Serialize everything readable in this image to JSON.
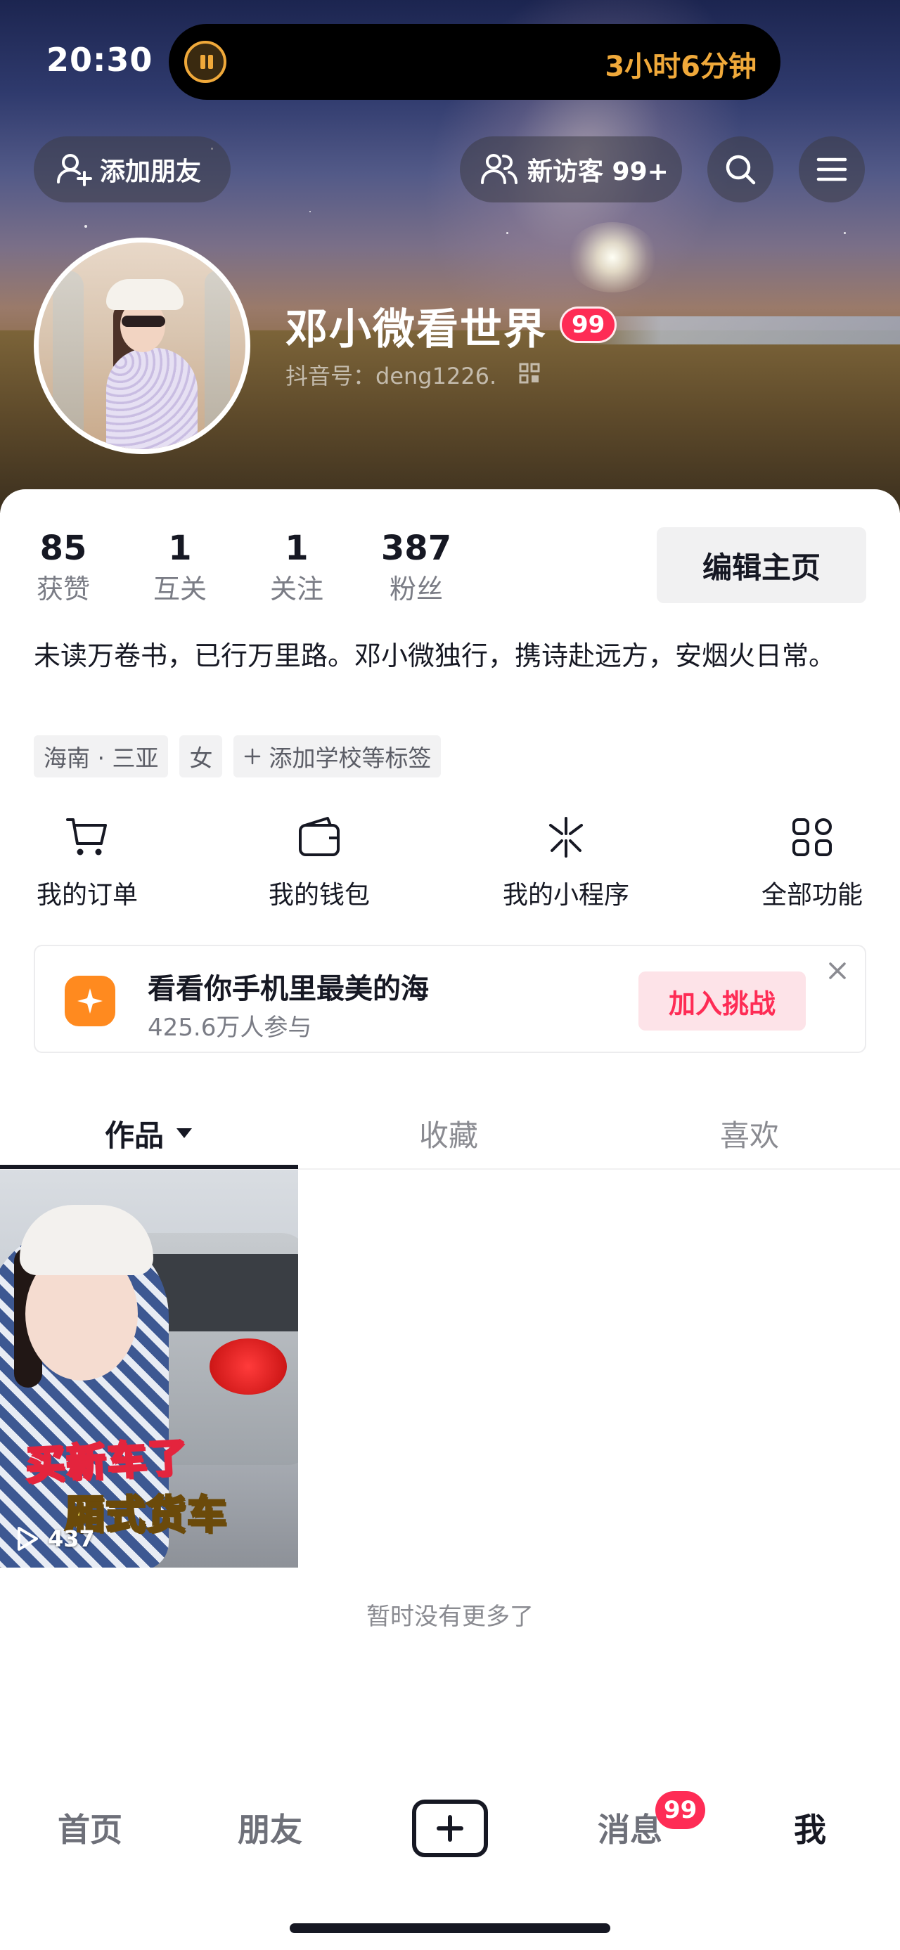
{
  "status_bar": {
    "time": "20:30",
    "live_activity_timer": "3小时6分钟"
  },
  "header": {
    "add_friend_label": "添加朋友",
    "new_visitors_label": "新访客 99+",
    "icons": [
      "add-friend-icon",
      "visitors-icon",
      "search-icon",
      "menu-icon"
    ]
  },
  "profile": {
    "nickname": "邓小微看世界",
    "level_badge": "99",
    "douyin_id": "抖音号：deng1226."
  },
  "stats": [
    {
      "value": "85",
      "label": "获赞"
    },
    {
      "value": "1",
      "label": "互关"
    },
    {
      "value": "1",
      "label": "关注"
    },
    {
      "value": "387",
      "label": "粉丝"
    }
  ],
  "edit_profile_label": "编辑主页",
  "bio": "未读万卷书，已行万里路。邓小微独行，携诗赴远方，安烟火日常。",
  "tags": {
    "location": "海南 · 三亚",
    "gender": "女",
    "add_tag": "添加学校等标签"
  },
  "functions": [
    {
      "label": "我的订单",
      "icon": "cart-icon"
    },
    {
      "label": "我的钱包",
      "icon": "wallet-icon"
    },
    {
      "label": "我的小程序",
      "icon": "mini-program-icon"
    },
    {
      "label": "全部功能",
      "icon": "all-functions-icon"
    }
  ],
  "challenge": {
    "title": "看看你手机里最美的海",
    "participants": "425.6万人参与",
    "join_label": "加入挑战"
  },
  "content_tabs": {
    "works": "作品",
    "favorites": "收藏",
    "likes": "喜欢",
    "active": "works"
  },
  "video": {
    "caption_line1": "买新车了",
    "caption_line2": "厢式货车",
    "play_count": "437"
  },
  "no_more_text": "暂时没有更多了",
  "bottom_nav": {
    "home": "首页",
    "friends": "朋友",
    "messages": "消息",
    "messages_badge": "99",
    "me": "我"
  },
  "colors": {
    "brand_red": "#fe2c55",
    "timer_orange": "#f0a93a",
    "challenge_orange": "#ff8a1f",
    "text_primary": "#161823",
    "text_secondary": "#7a7c85"
  }
}
